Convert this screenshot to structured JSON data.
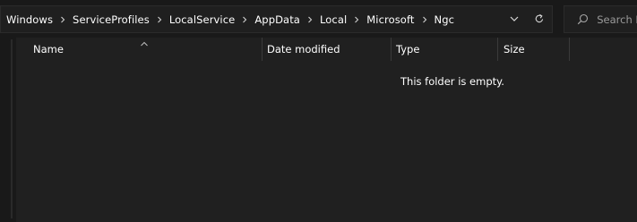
{
  "address_bar": {
    "breadcrumbs": [
      "Windows",
      "ServiceProfiles",
      "LocalService",
      "AppData",
      "Local",
      "Microsoft",
      "Ngc"
    ]
  },
  "search": {
    "placeholder": "Search N"
  },
  "columns": {
    "name": "Name",
    "date_modified": "Date modified",
    "type": "Type",
    "size": "Size"
  },
  "content": {
    "empty_message": "This folder is empty."
  },
  "icons": {
    "breadcrumb_separator": "chevron-right-icon",
    "history_dropdown": "chevron-down-icon",
    "refresh": "refresh-icon",
    "search": "search-icon",
    "sort": "sort-ascending-icon"
  }
}
